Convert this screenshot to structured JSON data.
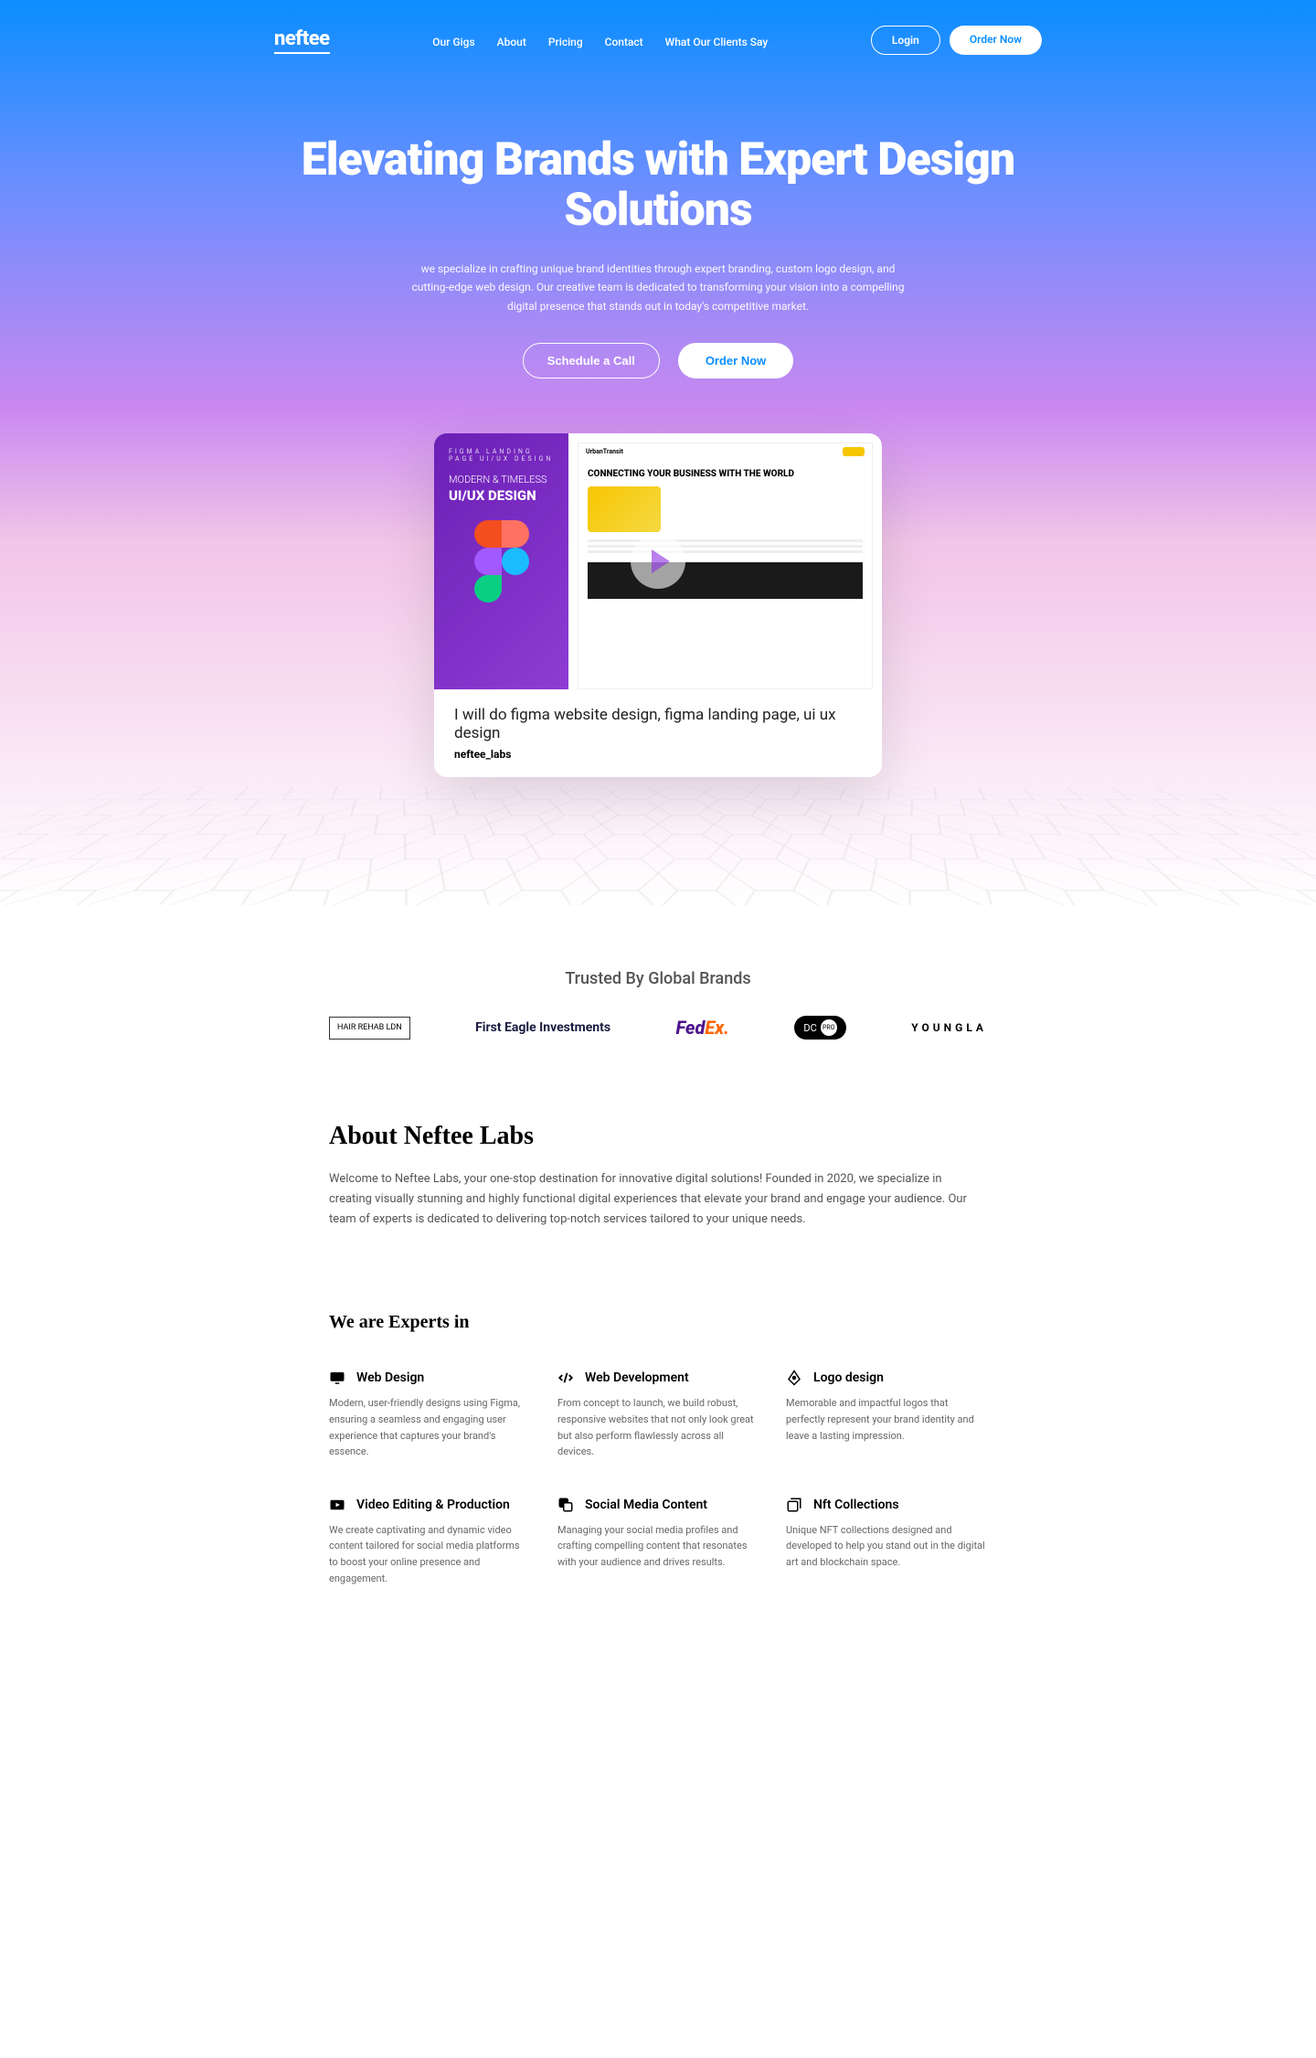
{
  "brand": "neftee",
  "nav": {
    "items": [
      "Our Gigs",
      "About",
      "Pricing",
      "Contact",
      "What Our Clients Say"
    ],
    "login": "Login",
    "order": "Order Now"
  },
  "hero": {
    "title": "Elevating Brands with Expert Design Solutions",
    "subtitle": "we specialize in crafting unique brand identities through expert branding, custom logo design, and cutting-edge web design. Our creative team is dedicated to transforming your vision into a compelling digital presence that stands out in today's competitive market.",
    "cta1": "Schedule a Call",
    "cta2": "Order Now"
  },
  "gig": {
    "overlay_label": "FIGMA LANDING PAGE UI/UX DESIGN",
    "overlay_t1": "MODERN & TIMELESS",
    "overlay_t2": "UI/UX DESIGN",
    "mock_headline": "CONNECTING YOUR BUSINESS WITH THE WORLD",
    "title": "I will do figma website design, figma landing page, ui ux design",
    "author": "neftee_labs"
  },
  "trusted": {
    "title": "Trusted By Global Brands",
    "brands": {
      "hair": "HAIR REHAB LDN",
      "firsteagle": "First Eagle Investments",
      "fedex_a": "Fed",
      "fedex_b": "Ex.",
      "dcpro": "PRO",
      "dcpro_txt": "DC",
      "youngla": "YOUNGLA"
    }
  },
  "about": {
    "heading": "About Neftee Labs",
    "text": "Welcome to Neftee Labs, your one-stop destination for innovative digital solutions! Founded in 2020, we specialize in creating visually stunning and highly functional digital experiences that elevate your brand and engage your audience. Our team of experts is dedicated to delivering top-notch services tailored to your unique needs."
  },
  "experts": {
    "heading": "We are Experts in",
    "items": [
      {
        "title": "Web Design",
        "desc": "Modern, user-friendly designs using Figma, ensuring a seamless and engaging user experience that captures your brand's essence."
      },
      {
        "title": "Web Development",
        "desc": "From concept to launch, we build robust, responsive websites that not only look great but also perform flawlessly across all devices."
      },
      {
        "title": "Logo design",
        "desc": "Memorable and impactful logos that perfectly represent your brand identity and leave a lasting impression."
      },
      {
        "title": "Video Editing & Production",
        "desc": "We create captivating and dynamic video content tailored for social media platforms to boost your online presence and engagement."
      },
      {
        "title": "Social Media Content",
        "desc": "Managing your social media profiles and crafting compelling content that resonates with your audience and drives results."
      },
      {
        "title": "Nft Collections",
        "desc": "Unique NFT collections designed and developed to help you stand out in the digital art and blockchain space."
      }
    ]
  }
}
